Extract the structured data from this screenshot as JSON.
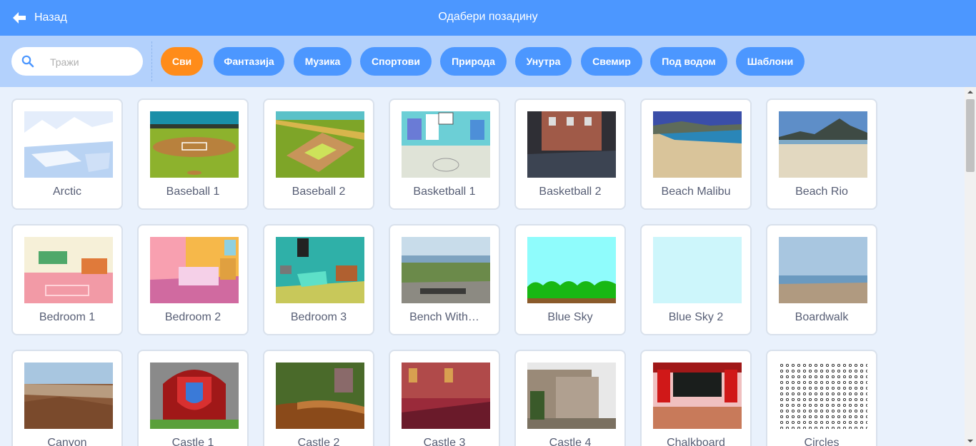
{
  "header": {
    "back_label": "Назад",
    "title": "Одабери позадину"
  },
  "search": {
    "placeholder": "Тражи"
  },
  "categories": [
    "Сви",
    "Фантазија",
    "Музика",
    "Спортови",
    "Природа",
    "Унутра",
    "Свемир",
    "Под водом",
    "Шаблони"
  ],
  "active_category": "Сви",
  "backdrops": [
    "Arctic",
    "Baseball 1",
    "Baseball 2",
    "Basketball 1",
    "Basketball 2",
    "Beach Malibu",
    "Beach Rio",
    "Bedroom 1",
    "Bedroom 2",
    "Bedroom 3",
    "Bench With…",
    "Blue Sky",
    "Blue Sky 2",
    "Boardwalk",
    "Canyon",
    "Castle 1",
    "Castle 2",
    "Castle 3",
    "Castle 4",
    "Chalkboard",
    "Circles"
  ],
  "colors": {
    "header": "#4c97ff",
    "filter_bar": "#b3d1fc",
    "active_chip": "#ff8c1a",
    "chip": "#4c97ff",
    "background": "#e9f1fc"
  },
  "icons": {
    "back": "back-arrow-icon",
    "search": "search-icon"
  }
}
